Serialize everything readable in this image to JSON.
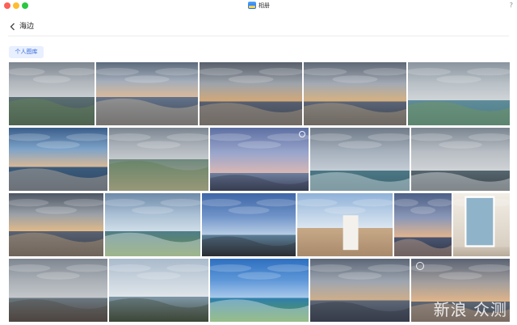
{
  "window": {
    "title": "相册",
    "help_label": "?"
  },
  "header": {
    "album_title": "海边"
  },
  "filter": {
    "tag_label": "个人图库"
  },
  "watermark": {
    "text": "新浪 众测"
  },
  "photos": [
    {
      "name": "photo-cloudy-sea-green-hill",
      "sky": [
        "#7d858f",
        "#aeb4ba",
        "#c9cdd1"
      ],
      "horizon": 0.55,
      "ground": [
        "#5b6f72",
        "#3f4e52"
      ],
      "accent": "#6b8b4c",
      "icon": "landscape"
    },
    {
      "name": "photo-sunset-clouds-sea",
      "sky": [
        "#5c6a7c",
        "#a4aebb",
        "#d9b99b"
      ],
      "horizon": 0.55,
      "ground": [
        "#64738a",
        "#3b4556"
      ],
      "accent": "#e2c8a3",
      "icon": "landscape"
    },
    {
      "name": "photo-dramatic-clouds-sea",
      "sky": [
        "#585f6b",
        "#9ea4ab",
        "#d3a777"
      ],
      "horizon": 0.62,
      "ground": [
        "#576070",
        "#3e4553"
      ],
      "accent": "#cfae86",
      "icon": "landscape"
    },
    {
      "name": "photo-clouds-sea-person",
      "sky": [
        "#5f6876",
        "#a3aab4",
        "#d7b17f"
      ],
      "horizon": 0.62,
      "ground": [
        "#5c6677",
        "#39414f"
      ],
      "accent": "#d2b183",
      "icon": "landscape"
    },
    {
      "name": "photo-wind-turbines-island",
      "sky": [
        "#8a949e",
        "#b8c0c6",
        "#cfd4d7"
      ],
      "horizon": 0.6,
      "ground": [
        "#5f8c9a",
        "#4d7a84"
      ],
      "accent": "#7a9a4a",
      "icon": "landscape"
    },
    {
      "name": "photo-blue-sky-sea-sunset",
      "sky": [
        "#3a5e8a",
        "#7ea3c9",
        "#d8b896"
      ],
      "horizon": 0.62,
      "ground": [
        "#3c5c7c",
        "#2b4462"
      ],
      "accent": "#e4c7a2",
      "icon": "landscape"
    },
    {
      "name": "photo-green-island-boardwalk",
      "sky": [
        "#7b8591",
        "#aab1b8",
        "#c4c9cd"
      ],
      "horizon": 0.5,
      "ground": [
        "#6e8a7e",
        "#b9a894"
      ],
      "accent": "#5b7a45",
      "icon": "landscape"
    },
    {
      "name": "photo-twilight-sea-people",
      "sky": [
        "#5d6fa2",
        "#9aa6cc",
        "#d9b7b4"
      ],
      "horizon": 0.72,
      "ground": [
        "#6f7f9e",
        "#3c435a"
      ],
      "accent": "#2f3344",
      "icon": "landscape"
    },
    {
      "name": "photo-hazy-turbines-sea",
      "sky": [
        "#6f7a88",
        "#a5b0bc",
        "#c4ccd4"
      ],
      "horizon": 0.68,
      "ground": [
        "#4c7784",
        "#3b6470"
      ],
      "accent": "#ffffff",
      "icon": "landscape"
    },
    {
      "name": "photo-turbines-rocky-shore",
      "sky": [
        "#7b8591",
        "#b7bdc3",
        "#cfd3d6"
      ],
      "horizon": 0.68,
      "ground": [
        "#56666f",
        "#3d464c"
      ],
      "accent": "#ffffff",
      "icon": "landscape"
    },
    {
      "name": "photo-golden-clouds-sea",
      "sky": [
        "#4d5663",
        "#9aa0a8",
        "#e0b988"
      ],
      "horizon": 0.6,
      "ground": [
        "#5a6373",
        "#373d48"
      ],
      "accent": "#d9b07a",
      "icon": "landscape"
    },
    {
      "name": "photo-turbines-coast-green",
      "sky": [
        "#6d8aa8",
        "#a9bfd4",
        "#cfdde7"
      ],
      "horizon": 0.6,
      "ground": [
        "#4f7d8a",
        "#6b8e4c"
      ],
      "accent": "#ffffff",
      "icon": "landscape"
    },
    {
      "name": "photo-blue-sky-black-rocks",
      "sky": [
        "#3e66a6",
        "#6f93c8",
        "#b8cde4"
      ],
      "horizon": 0.66,
      "ground": [
        "#5d7f99",
        "#2a2f35"
      ],
      "accent": "#2a2e33",
      "icon": "landscape"
    },
    {
      "name": "photo-girl-on-rocks",
      "sky": [
        "#8fb1d8",
        "#b9cfe6",
        "#dbe6f0"
      ],
      "horizon": 0.55,
      "ground": [
        "#c8a987",
        "#a88a6c"
      ],
      "accent": "#ffffff",
      "icon": "portrait"
    },
    {
      "name": "photo-sunset-horizon-clouds",
      "sky": [
        "#4d5f86",
        "#8b98b8",
        "#e3b48d"
      ],
      "horizon": 0.7,
      "ground": [
        "#4a5570",
        "#2f3648"
      ],
      "accent": "#e8b58b",
      "icon": "landscape"
    },
    {
      "name": "photo-seascape-painting-room",
      "sky": [
        "#f2ede6",
        "#e4ddd2",
        "#d8cfc2"
      ],
      "horizon": 0.85,
      "ground": [
        "#cfc5b7",
        "#b8ab9b"
      ],
      "accent": "#8fb3c9",
      "icon": "painting"
    },
    {
      "name": "photo-grey-sky-rocky-beach",
      "sky": [
        "#7e8690",
        "#a9afb5",
        "#c3c7cb"
      ],
      "horizon": 0.62,
      "ground": [
        "#6a7880",
        "#4e4540"
      ],
      "accent": "#4e4540",
      "icon": "landscape"
    },
    {
      "name": "photo-tree-branch-sea",
      "sky": [
        "#a9bacb",
        "#c8d3dd",
        "#dfe5ea"
      ],
      "horizon": 0.6,
      "ground": [
        "#7f98a8",
        "#3f4a3c"
      ],
      "accent": "#3a3f2e",
      "icon": "landscape"
    },
    {
      "name": "photo-turbines-bright-blue",
      "sky": [
        "#2d6fc0",
        "#5e97d8",
        "#a9c9ea"
      ],
      "horizon": 0.62,
      "ground": [
        "#2f7fae",
        "#5f9a4a"
      ],
      "accent": "#ffffff",
      "icon": "landscape"
    },
    {
      "name": "photo-clouds-beach-people",
      "sky": [
        "#5b6676",
        "#9ea6b1",
        "#cfae8a"
      ],
      "horizon": 0.66,
      "ground": [
        "#5d6777",
        "#3d4452"
      ],
      "accent": "#2a2f38",
      "icon": "landscape"
    },
    {
      "name": "photo-sunset-clouds-beach",
      "sky": [
        "#5a6272",
        "#a29e9e",
        "#e0b488"
      ],
      "horizon": 0.68,
      "ground": [
        "#5f6775",
        "#40464f"
      ],
      "accent": "#e2b385",
      "icon": "landscape"
    }
  ]
}
